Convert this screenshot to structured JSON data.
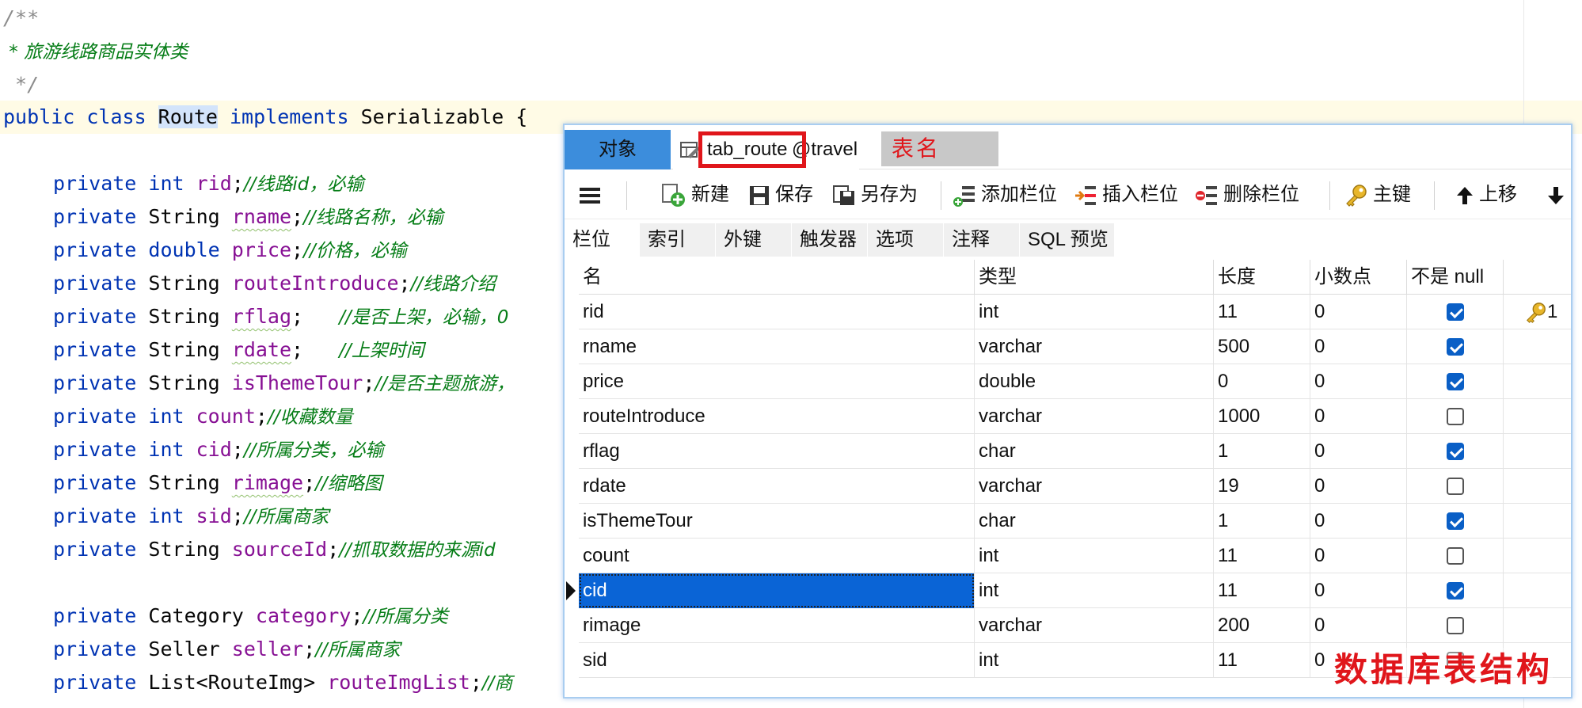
{
  "code": {
    "lines": [
      "/**",
      " * 旅游线路商品实体类",
      " */",
      "public class Route implements Serializable {",
      "private int rid;//线路id，必输",
      "private String rname;//线路名称，必输",
      "private double price;//价格，必输",
      "private String routeIntroduce;//线路介绍",
      "private String rflag;   //是否上架，必输，0",
      "private String rdate;   //上架时间",
      "private String isThemeTour;//是否主题旅游，",
      "private int count;//收藏数量",
      "private int cid;//所属分类，必输",
      "private String rimage;//缩略图",
      "private int sid;//所属商家",
      "private String sourceId;//抓取数据的来源id",
      "private Category category;//所属分类",
      "private Seller seller;//所属商家",
      "private List<RouteImg> routeImgList;//商"
    ]
  },
  "designer": {
    "tab_objects": "对象",
    "tab_table": "tab_route",
    "tab_db": "@travel",
    "annotation_tablename": "表名",
    "annotation_structure": "数据库表结构",
    "toolbar": {
      "new": "新建",
      "save": "保存",
      "save_as": "另存为",
      "add_field": "添加栏位",
      "insert_field": "插入栏位",
      "delete_field": "删除栏位",
      "primary_key": "主键",
      "move_up": "上移"
    },
    "subtabs": [
      "栏位",
      "索引",
      "外键",
      "触发器",
      "选项",
      "注释",
      "SQL 预览"
    ],
    "columns": [
      "名",
      "类型",
      "长度",
      "小数点",
      "不是 null"
    ],
    "key_label": "1",
    "rows": [
      {
        "name": "rid",
        "type": "int",
        "length": "11",
        "decimals": "0",
        "not_null": true,
        "key": true
      },
      {
        "name": "rname",
        "type": "varchar",
        "length": "500",
        "decimals": "0",
        "not_null": true
      },
      {
        "name": "price",
        "type": "double",
        "length": "0",
        "decimals": "0",
        "not_null": true
      },
      {
        "name": "routeIntroduce",
        "type": "varchar",
        "length": "1000",
        "decimals": "0",
        "not_null": false
      },
      {
        "name": "rflag",
        "type": "char",
        "length": "1",
        "decimals": "0",
        "not_null": true
      },
      {
        "name": "rdate",
        "type": "varchar",
        "length": "19",
        "decimals": "0",
        "not_null": false
      },
      {
        "name": "isThemeTour",
        "type": "char",
        "length": "1",
        "decimals": "0",
        "not_null": true
      },
      {
        "name": "count",
        "type": "int",
        "length": "11",
        "decimals": "0",
        "not_null": false
      },
      {
        "name": "cid",
        "type": "int",
        "length": "11",
        "decimals": "0",
        "not_null": true,
        "selected": true
      },
      {
        "name": "rimage",
        "type": "varchar",
        "length": "200",
        "decimals": "0",
        "not_null": false
      },
      {
        "name": "sid",
        "type": "int",
        "length": "11",
        "decimals": "0",
        "not_null": false
      }
    ]
  }
}
